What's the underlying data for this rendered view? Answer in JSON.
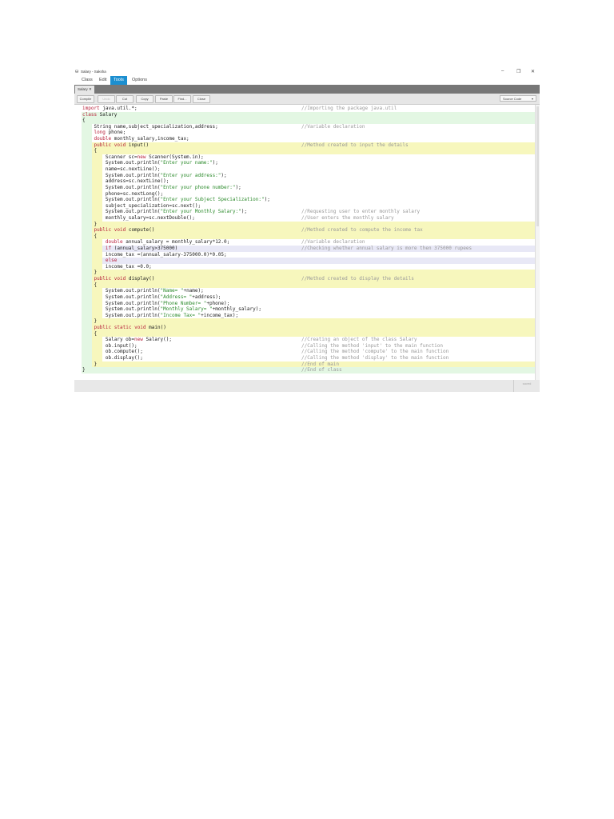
{
  "window": {
    "title": "Salary - Saksha",
    "minimize": "–",
    "restore": "❐",
    "close": "✕"
  },
  "menu": [
    "Class",
    "Edit",
    "Tools",
    "Options"
  ],
  "tab": {
    "label": "Salary",
    "close": "✕"
  },
  "toolbar": {
    "buttons": [
      "Compile",
      "Undo",
      "Cut",
      "Copy",
      "Paste",
      "Find...",
      "Close"
    ],
    "view": "Source Code",
    "view_arrow": "▾"
  },
  "status": "saved",
  "colors": {
    "green": "#e3f7e3",
    "yellow": "#f7f7bd",
    "white": "#ffffff",
    "lavender": "#e8e8f6",
    "accent": "#1c8fd0"
  },
  "lines": [
    {
      "code": "import java.util.*;",
      "comment": "//Importing the package java.util",
      "scope": "t"
    },
    {
      "code": "class Salary",
      "comment": "",
      "scope": "c"
    },
    {
      "code": "{",
      "comment": "",
      "scope": "c"
    },
    {
      "code": "    String name,subject_specialization,address;",
      "comment": "//Variable declaration",
      "scope": "f"
    },
    {
      "code": "    long phone;",
      "comment": "",
      "scope": "f"
    },
    {
      "code": "    double monthly_salary,income_tax;",
      "comment": "",
      "scope": "f"
    },
    {
      "code": "    public void input()",
      "comment": "//Method created to input the details",
      "scope": "m"
    },
    {
      "code": "    {",
      "comment": "",
      "scope": "m"
    },
    {
      "code": "        Scanner sc=new Scanner(System.in);",
      "comment": "",
      "scope": "b"
    },
    {
      "code": "        System.out.println(\"Enter your name:\");",
      "comment": "",
      "scope": "b"
    },
    {
      "code": "        name=sc.nextLine();",
      "comment": "",
      "scope": "b"
    },
    {
      "code": "        System.out.println(\"Enter your address:\");",
      "comment": "",
      "scope": "b"
    },
    {
      "code": "        address=sc.nextLine();",
      "comment": "",
      "scope": "b"
    },
    {
      "code": "        System.out.println(\"Enter your phone number:\");",
      "comment": "",
      "scope": "b"
    },
    {
      "code": "        phone=sc.nextLong();",
      "comment": "",
      "scope": "b"
    },
    {
      "code": "        System.out.println(\"Enter your Subject Specialization:\");",
      "comment": "",
      "scope": "b"
    },
    {
      "code": "        subject_specialization=sc.next();",
      "comment": "",
      "scope": "b"
    },
    {
      "code": "        System.out.println(\"Enter your Monthly Salary:\");",
      "comment": "//Requesting user to enter monthly salary",
      "scope": "b"
    },
    {
      "code": "        monthly_salary=sc.nextDouble();",
      "comment": "//User enters the monthly salary",
      "scope": "b"
    },
    {
      "code": "    }",
      "comment": "",
      "scope": "m"
    },
    {
      "code": "    public void compute()",
      "comment": "//Method created to compute the income tax",
      "scope": "m"
    },
    {
      "code": "    {",
      "comment": "",
      "scope": "m"
    },
    {
      "code": "        double annual_salary = monthly_salary*12.0;",
      "comment": "//Variable declaration",
      "scope": "b"
    },
    {
      "code": "        if (annual_salary>375000)",
      "comment": "//Checking whether annual salary is more then 375000 rupees",
      "scope": "i"
    },
    {
      "code": "        income_tax =(annual_salary-375000.0)*0.05;",
      "comment": "",
      "scope": "b"
    },
    {
      "code": "        else",
      "comment": "",
      "scope": "i"
    },
    {
      "code": "        income_tax =0.0;",
      "comment": "",
      "scope": "b"
    },
    {
      "code": "    }",
      "comment": "",
      "scope": "m"
    },
    {
      "code": "    public void display()",
      "comment": "//Method created to display the details",
      "scope": "m"
    },
    {
      "code": "    {",
      "comment": "",
      "scope": "m"
    },
    {
      "code": "        System.out.println(\"Name= \"+name);",
      "comment": "",
      "scope": "b"
    },
    {
      "code": "        System.out.println(\"Address= \"+address);",
      "comment": "",
      "scope": "b"
    },
    {
      "code": "        System.out.println(\"Phone Number= \"+phone);",
      "comment": "",
      "scope": "b"
    },
    {
      "code": "        System.out.println(\"Monthly Salary= \"+monthly_salary);",
      "comment": "",
      "scope": "b"
    },
    {
      "code": "        System.out.println(\"Income Tax= \"+income_tax);",
      "comment": "",
      "scope": "b"
    },
    {
      "code": "    }",
      "comment": "",
      "scope": "m"
    },
    {
      "code": "    public static void main()",
      "comment": "",
      "scope": "m"
    },
    {
      "code": "    {",
      "comment": "",
      "scope": "m"
    },
    {
      "code": "        Salary ob=new Salary();",
      "comment": "//Creating an object of the class Salary",
      "scope": "b"
    },
    {
      "code": "        ob.input();",
      "comment": "//Calling the method 'input' to the main function",
      "scope": "b"
    },
    {
      "code": "        ob.compute();",
      "comment": "//Calling the method 'compute' to the main function",
      "scope": "b"
    },
    {
      "code": "        ob.display();",
      "comment": "//Calling the method 'display' to the main function",
      "scope": "b"
    },
    {
      "code": "    }",
      "comment": "//End of main",
      "scope": "m"
    },
    {
      "code": "}",
      "comment": "//End of class",
      "scope": "c"
    }
  ]
}
